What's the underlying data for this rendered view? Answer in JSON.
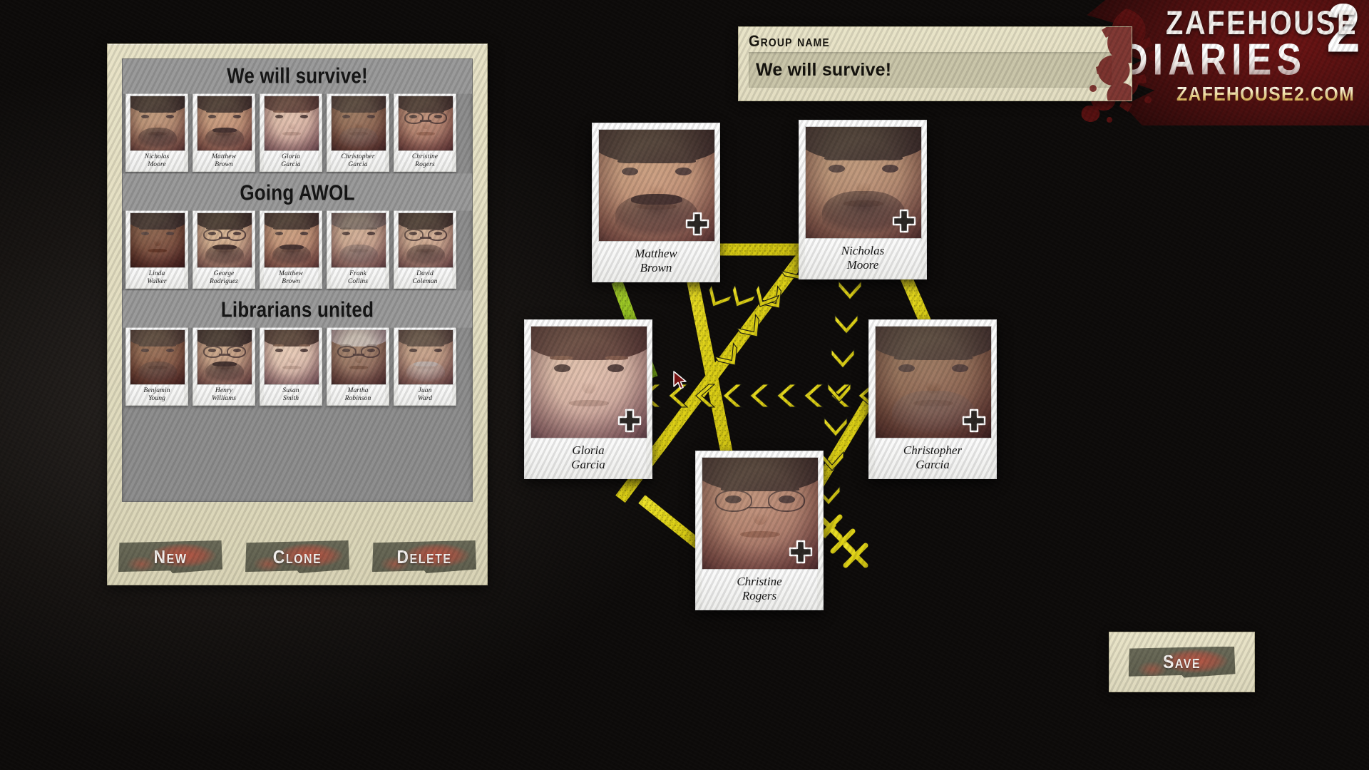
{
  "logo": {
    "line1": "ZAFEHOUSE",
    "line2": "DIARIES",
    "big_number": "2",
    "url": "ZAFEHOUSE2.COM"
  },
  "group_name_field": {
    "label": "Group name",
    "value": "We will survive!",
    "placeholder": "Group name"
  },
  "group_panel": {
    "groups": [
      {
        "title": "We will survive!",
        "members": [
          {
            "first": "Nicholas",
            "last": "Moore"
          },
          {
            "first": "Matthew",
            "last": "Brown"
          },
          {
            "first": "Gloria",
            "last": "Garcia"
          },
          {
            "first": "Christopher",
            "last": "Garcia"
          },
          {
            "first": "Christine",
            "last": "Rogers"
          }
        ]
      },
      {
        "title": "Going AWOL",
        "members": [
          {
            "first": "Linda",
            "last": "Walker"
          },
          {
            "first": "George",
            "last": "Rodriguez"
          },
          {
            "first": "Matthew",
            "last": "Brown"
          },
          {
            "first": "Frank",
            "last": "Collins"
          },
          {
            "first": "David",
            "last": "Coleman"
          }
        ]
      },
      {
        "title": "Librarians united",
        "members": [
          {
            "first": "Benjamin",
            "last": "Young"
          },
          {
            "first": "Henry",
            "last": "Williams"
          },
          {
            "first": "Susan",
            "last": "Smith"
          },
          {
            "first": "Martha",
            "last": "Robinson"
          },
          {
            "first": "Juan",
            "last": "Ward"
          }
        ]
      }
    ],
    "buttons": {
      "new": "New",
      "clone": "Clone",
      "delete": "Delete"
    }
  },
  "board": {
    "cards": [
      {
        "first": "Matthew",
        "last": "Brown",
        "plus_icon": "plus-icon"
      },
      {
        "first": "Nicholas",
        "last": "Moore",
        "plus_icon": "plus-icon"
      },
      {
        "first": "Gloria",
        "last": "Garcia",
        "plus_icon": "plus-icon"
      },
      {
        "first": "Christopher",
        "last": "Garcia",
        "plus_icon": "plus-icon"
      },
      {
        "first": "Christine",
        "last": "Rogers",
        "plus_icon": "plus-icon"
      }
    ]
  },
  "save_button": {
    "label": "Save"
  },
  "colors": {
    "panel_cream": "#e8e3c7",
    "list_grey": "#8e8e8e",
    "button_olive": "#6a6a58",
    "blood_red": "#c45442",
    "link_yellow": "#e8dc19",
    "link_green": "#8fc31f",
    "logo_maroon": "#4e0f0f",
    "logo_gold": "#d9b45c",
    "cursor_red": "#7a1111"
  }
}
